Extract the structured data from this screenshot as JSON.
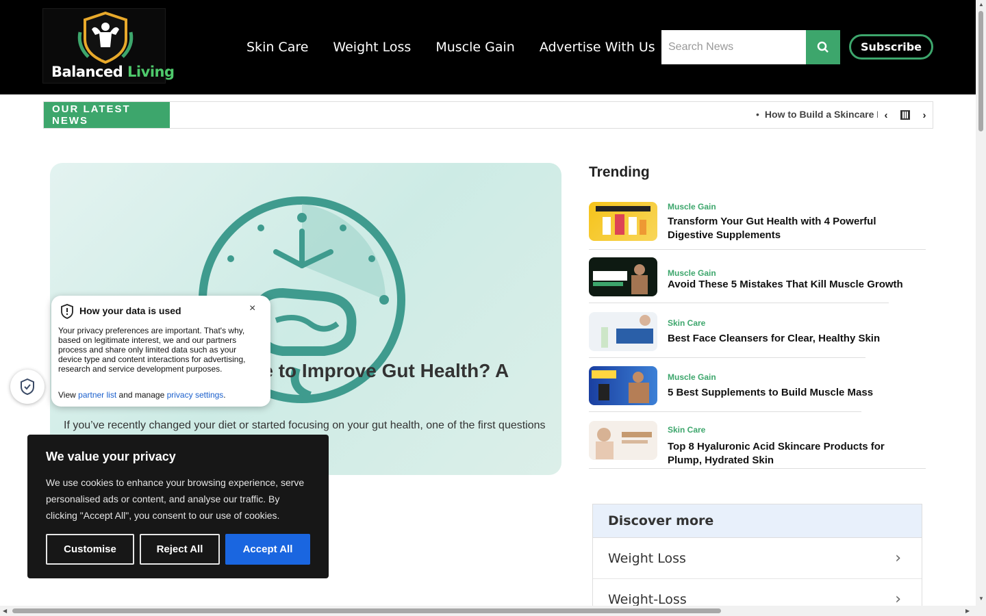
{
  "header": {
    "logo_word1": "Balanced",
    "logo_word2": "Living",
    "nav": [
      "Skin Care",
      "Weight Loss",
      "Muscle Gain",
      "Advertise With Us"
    ],
    "search_placeholder": "Search News",
    "subscribe_label": "Subscribe"
  },
  "ticker": {
    "label": "OUR LATEST NEWS",
    "item": "How to Build a Skincare Routine"
  },
  "hero": {
    "title": "How Long Does It Take to Improve Gut Health? A",
    "excerpt": "If you’ve recently changed your diet or started focusing on your gut health, one of the first questions"
  },
  "trending": {
    "heading": " Trending",
    "items": [
      {
        "category": "Muscle Gain",
        "title": "Transform Your Gut Health with 4 Powerful Digestive Supplements"
      },
      {
        "category": "Muscle Gain",
        "title": "Avoid These 5 Mistakes That Kill Muscle Growth"
      },
      {
        "category": "Skin Care",
        "title": "Best Face Cleansers for Clear, Healthy Skin"
      },
      {
        "category": "Muscle Gain",
        "title": "5 Best Supplements to Build Muscle Mass"
      },
      {
        "category": "Skin Care",
        "title": "Top 8 Hyaluronic Acid Skincare Products for Plump, Hydrated Skin"
      }
    ]
  },
  "discover": {
    "heading": "Discover more",
    "items": [
      "Weight Loss",
      "Weight-Loss"
    ]
  },
  "data_popup": {
    "title": "How your data is used",
    "body": "Your privacy preferences are important. That's why, based on legitimate interest, we and our partners process and share only limited data such as your device type and content interactions for advertising, research and service development purposes.",
    "foot_view": "View",
    "partner_link": "partner list",
    "foot_mid": "and manage",
    "settings_link": "privacy settings",
    "foot_end": "."
  },
  "cookie": {
    "title": "We value your privacy",
    "body": "We use cookies to enhance your browsing experience, serve personalised ads or content, and analyse our traffic. By clicking \"Accept All\", you consent to our use of cookies.",
    "customise": "Customise",
    "reject": "Reject All",
    "accept": "Accept All"
  },
  "colors": {
    "brand_green": "#3da66c",
    "accept_blue": "#1a66e0",
    "header_bg": "#000000"
  }
}
